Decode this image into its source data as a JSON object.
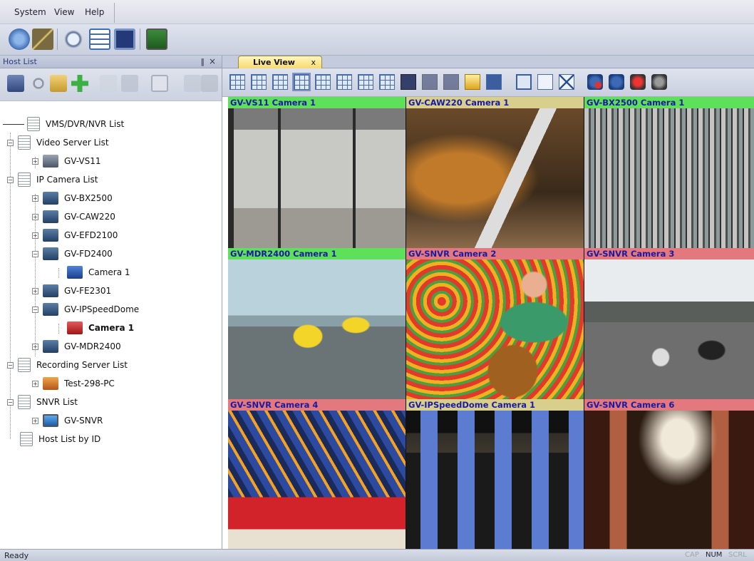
{
  "menu": {
    "items": [
      "System",
      "View",
      "Help"
    ]
  },
  "host_panel": {
    "title": "Host List",
    "pin_glyph": "‖",
    "close_glyph": "×",
    "tree": [
      {
        "label": "VMS/DVR/NVR List",
        "level": 0,
        "icon": "list-icon"
      },
      {
        "label": "Video Server List",
        "level": 0,
        "icon": "list-icon"
      },
      {
        "label": "GV-VS11",
        "level": 1,
        "icon": "video-server-icon"
      },
      {
        "label": "IP Camera List",
        "level": 0,
        "icon": "list-icon"
      },
      {
        "label": "GV-BX2500",
        "level": 1,
        "icon": "ip-camera-icon"
      },
      {
        "label": "GV-CAW220",
        "level": 1,
        "icon": "ip-camera-icon"
      },
      {
        "label": "GV-EFD2100",
        "level": 1,
        "icon": "ip-camera-icon"
      },
      {
        "label": "GV-FD2400",
        "level": 1,
        "icon": "ip-camera-icon"
      },
      {
        "label": "Camera 1",
        "level": 2,
        "icon": "camera-channel-icon"
      },
      {
        "label": "GV-FE2301",
        "level": 1,
        "icon": "ip-camera-icon"
      },
      {
        "label": "GV-IPSpeedDome",
        "level": 1,
        "icon": "ip-camera-icon"
      },
      {
        "label": "Camera 1",
        "level": 2,
        "icon": "camera-channel-active-icon"
      },
      {
        "label": "GV-MDR2400",
        "level": 1,
        "icon": "ip-camera-icon"
      },
      {
        "label": "Recording Server List",
        "level": 0,
        "icon": "list-icon"
      },
      {
        "label": "Test-298-PC",
        "level": 1,
        "icon": "recording-server-icon"
      },
      {
        "label": "SNVR List",
        "level": 0,
        "icon": "list-icon"
      },
      {
        "label": "GV-SNVR",
        "level": 1,
        "icon": "monitor-icon"
      },
      {
        "label": "Host List by ID",
        "level": 0,
        "icon": "list-icon"
      }
    ]
  },
  "document_tab": {
    "label": "Live View",
    "close_glyph": "x"
  },
  "cameras": [
    {
      "label": "GV-VS11 Camera 1",
      "status": "green"
    },
    {
      "label": "GV-CAW220 Camera 1",
      "status": "tan"
    },
    {
      "label": "GV-BX2500 Camera 1",
      "status": "green"
    },
    {
      "label": "GV-MDR2400 Camera 1",
      "status": "green"
    },
    {
      "label": "GV-SNVR Camera 2",
      "status": "pink"
    },
    {
      "label": "GV-SNVR Camera 3",
      "status": "pink"
    },
    {
      "label": "GV-SNVR Camera 4",
      "status": "pink"
    },
    {
      "label": "GV-IPSpeedDome Camera 1",
      "status": "tan"
    },
    {
      "label": "GV-SNVR Camera 6",
      "status": "pink"
    }
  ],
  "status_bar": {
    "text": "Ready",
    "indicators": [
      {
        "label": "CAP",
        "active": false
      },
      {
        "label": "NUM",
        "active": true
      },
      {
        "label": "SCRL",
        "active": false
      }
    ]
  },
  "colors": {
    "online": "#5ee05a",
    "connecting": "#d9cf8c",
    "offline": "#e3787e",
    "caption_text": "#1a1aa0"
  }
}
